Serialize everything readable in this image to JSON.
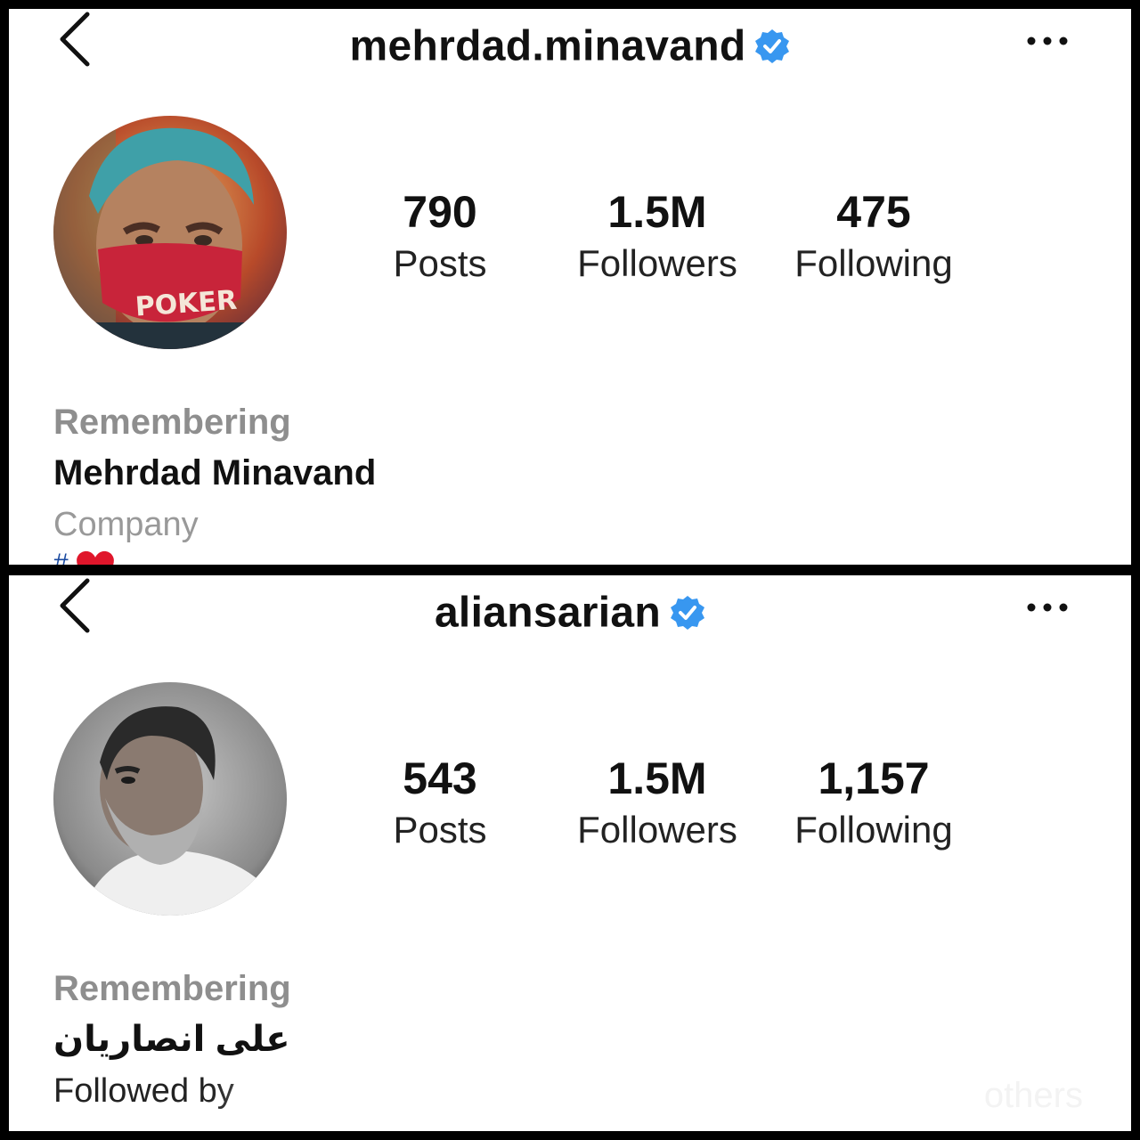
{
  "profiles": [
    {
      "username": "mehrdad.minavand",
      "verified": true,
      "stats": {
        "posts": "790",
        "posts_label": "Posts",
        "followers": "1.5M",
        "followers_label": "Followers",
        "following": "475",
        "following_label": "Following"
      },
      "bio": {
        "category": "Remembering",
        "full_name": "Mehrdad Minavand",
        "subtitle": "Company",
        "tagline": "#"
      }
    },
    {
      "username": "aliansarian",
      "verified": true,
      "stats": {
        "posts": "543",
        "posts_label": "Posts",
        "followers": "1.5M",
        "followers_label": "Followers",
        "following": "1,157",
        "following_label": "Following"
      },
      "bio": {
        "category": "Remembering",
        "full_name": "علی انصاریان",
        "subtitle": "Followed by",
        "others": "others"
      }
    }
  ],
  "colors": {
    "verified_badge": "#3897f0",
    "muted_text": "#8e8e8e",
    "mask_red": "#c8243a"
  },
  "icons": [
    "back-chevron-icon",
    "verified-badge-icon",
    "more-options-icon",
    "heart-icon"
  ]
}
